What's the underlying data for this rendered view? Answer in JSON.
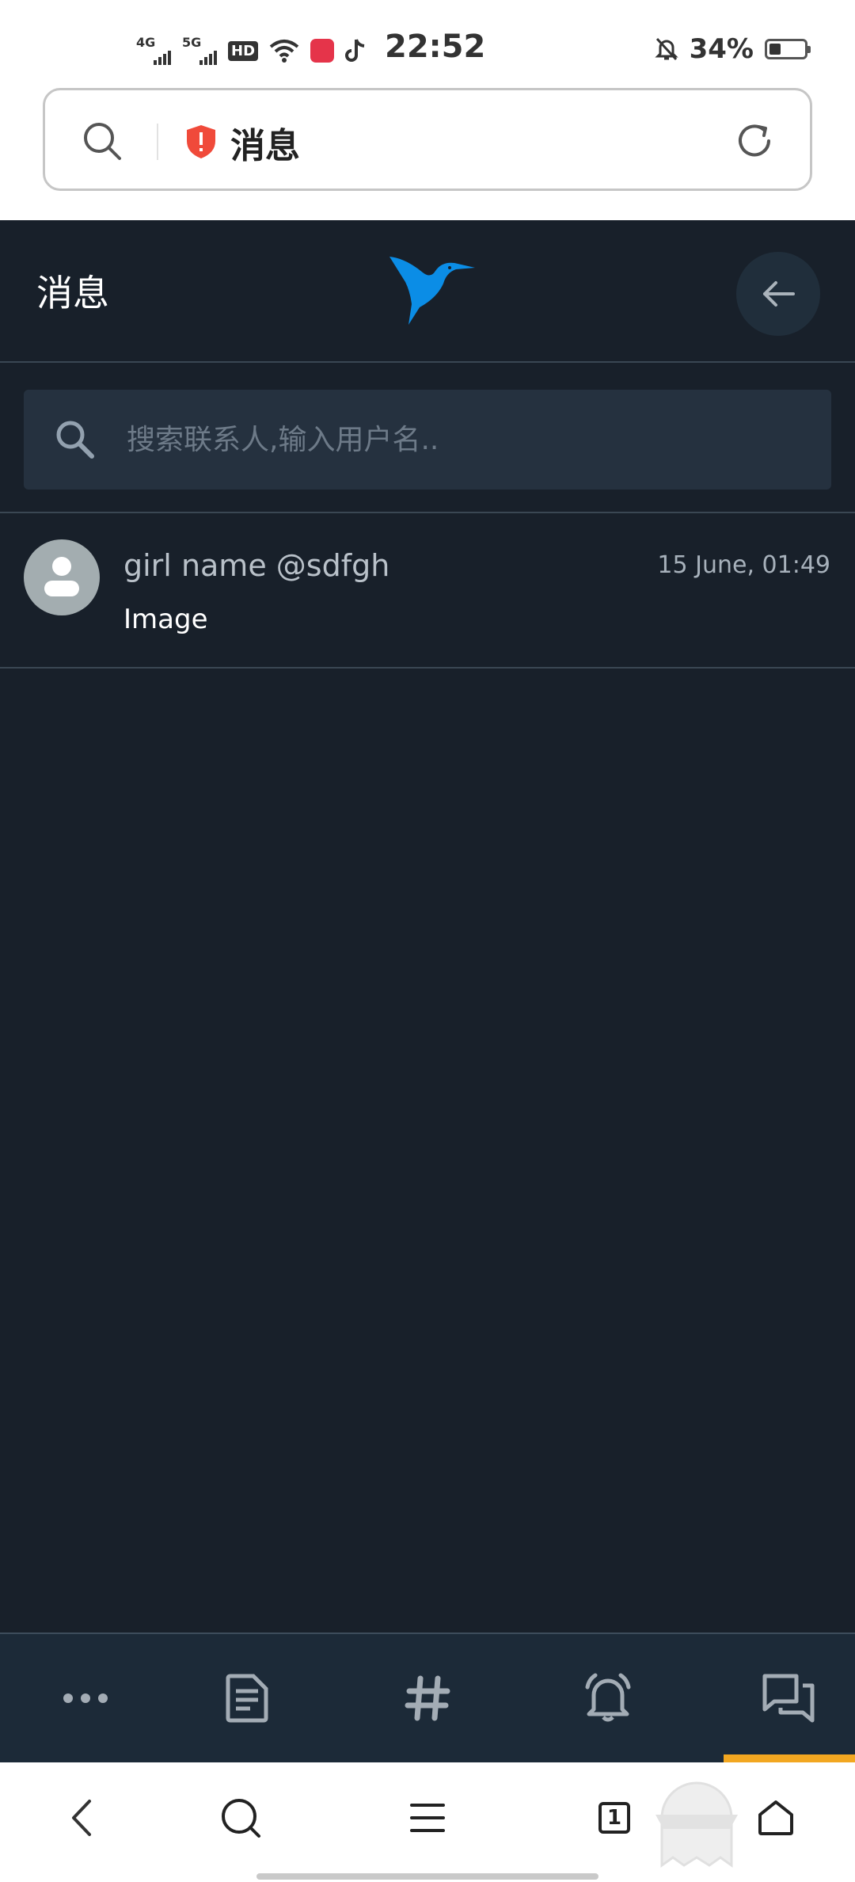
{
  "status_bar": {
    "signal_1": "4G",
    "signal_2": "5G",
    "hd_badge": "HD",
    "time": "22:52",
    "battery_percent": "34%",
    "battery_level": 0.34
  },
  "url_bar": {
    "title": "消息"
  },
  "header": {
    "title": "消息"
  },
  "search": {
    "placeholder": "搜索联系人,输入用户名.."
  },
  "conversations": [
    {
      "name": "girl name @sdfgh",
      "timestamp": "15 June, 01:49",
      "last_message": "Image"
    }
  ],
  "bottom_nav": {
    "items": [
      "more-icon",
      "document-icon",
      "hashtag-icon",
      "notifications-icon",
      "messages-icon"
    ],
    "active_index": 4
  },
  "system_nav": {
    "tab_count": "1"
  },
  "colors": {
    "background": "#18202a",
    "search_bg": "#25313f",
    "accent_active": "#f2a721",
    "logo_blue": "#0b8de6"
  }
}
